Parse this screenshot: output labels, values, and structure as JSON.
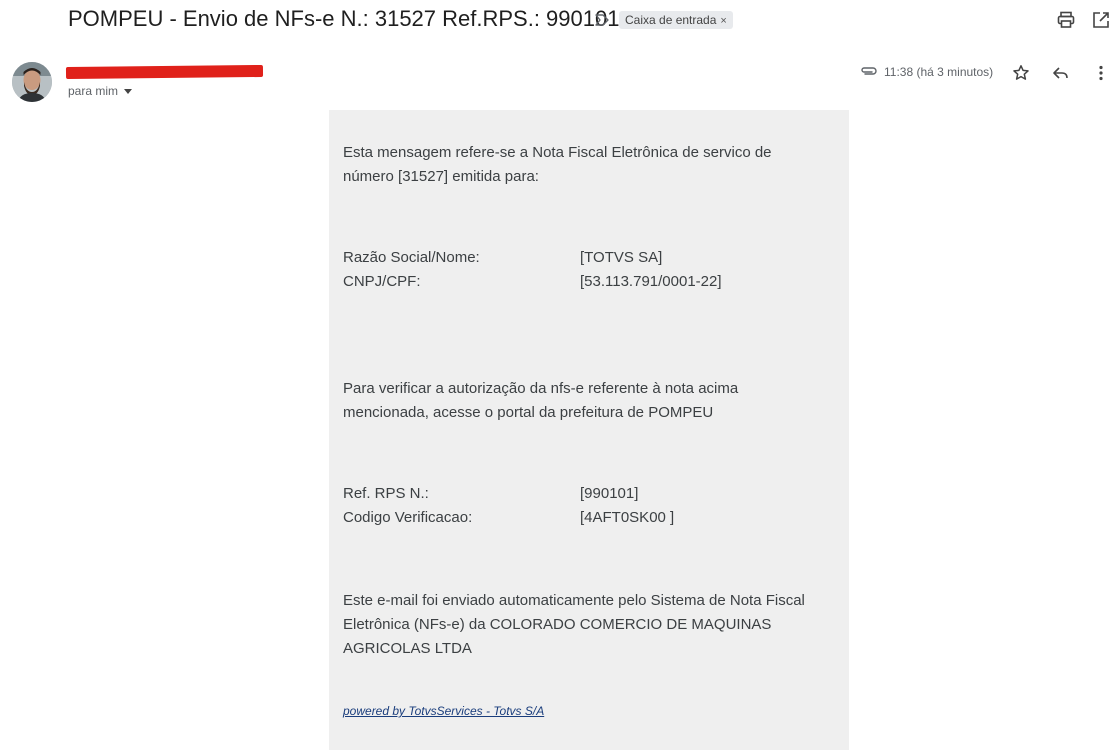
{
  "header": {
    "subject": "POMPEU - Envio de NFs-e N.: 31527 Ref.RPS.: 990101",
    "label_chip": "Caixa de entrada",
    "label_remove": "×",
    "icons": [
      "label-arrow-icon",
      "print-icon",
      "open-in-new-window-icon"
    ]
  },
  "sender": {
    "name_obscured": "~~~~~~~~~~~~~~",
    "to": "para mim",
    "time": "11:38 (há 3 minutos)",
    "icons": [
      "attachment-icon",
      "star-icon",
      "reply-icon",
      "more-vert-icon"
    ]
  },
  "body": {
    "intro": "Esta mensagem refere-se a Nota Fiscal Eletrônica de servico de número [31527] emitida para:",
    "razao_label": "Razão Social/Nome:",
    "razao_value": "[TOTVS SA]",
    "cnpj_label": "CNPJ/CPF:",
    "cnpj_value": "[53.113.791/0001-22]",
    "verify_text": "Para verificar a autorização da nfs-e referente à nota acima mencionada, acesse o portal da prefeitura de POMPEU",
    "rps_label": "Ref. RPS N.:",
    "rps_value": "[990101]",
    "codigo_label": "Codigo Verificacao:",
    "codigo_value": "[4AFT0SK00 ]",
    "footer_text": "Este e-mail foi enviado automaticamente pelo Sistema de Nota Fiscal Eletrônica (NFs-e) da COLORADO COMERCIO DE MAQUINAS AGRICOLAS LTDA",
    "powered_by": "powered by TotvsServices - Totvs S/A"
  },
  "colors": {
    "message_background": "#efefef",
    "redaction": "#e0211a",
    "link": "#1a3d7c"
  }
}
